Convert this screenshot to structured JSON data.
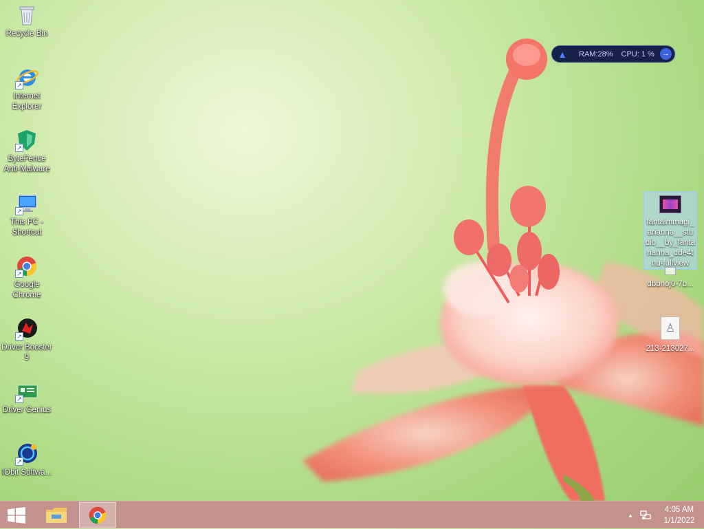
{
  "desktop": {
    "icons": [
      {
        "label": "Recycle Bin",
        "icon": "recycle-bin-icon"
      },
      {
        "label": "Internet Explorer",
        "icon": "internet-explorer-icon"
      },
      {
        "label": "ByteFence Anti-Malware",
        "icon": "bytefence-icon"
      },
      {
        "label": "This PC - Shortcut",
        "icon": "this-pc-icon"
      },
      {
        "label": "Google Chrome",
        "icon": "chrome-icon"
      },
      {
        "label": "Driver Booster 9",
        "icon": "driver-booster-icon"
      },
      {
        "label": "Driver Genius",
        "icon": "driver-genius-icon"
      },
      {
        "label": "IObit Softwa...",
        "icon": "iobit-icon"
      }
    ],
    "right_files": [
      {
        "label": "fantaimmagi_arianna__stu dio__by_fanta rianna_dde4t nu-fullview",
        "icon": "image-file-icon",
        "selected": true
      },
      {
        "label": "dbbnoj0-7b...",
        "icon": "image-file-icon",
        "selected": false
      },
      {
        "label": "213-213027...",
        "icon": "image-file-icon",
        "selected": false
      }
    ]
  },
  "widget": {
    "ram_label": "RAM:28%",
    "cpu_label": "CPU: 1 %",
    "icon": "rocket-icon"
  },
  "taskbar": {
    "start_icon": "windows-logo-icon",
    "pinned": [
      {
        "name": "file-explorer",
        "icon": "folder-icon"
      },
      {
        "name": "chrome",
        "icon": "chrome-icon",
        "active": true
      }
    ],
    "tray": {
      "chevron": "▲",
      "network_icon": "network-icon",
      "time": "4:05 AM",
      "date": "1/1/2022"
    }
  },
  "colors": {
    "taskbar": "#c4928c",
    "widget_bg": "#17214a",
    "widget_accent": "#3b63e0"
  }
}
